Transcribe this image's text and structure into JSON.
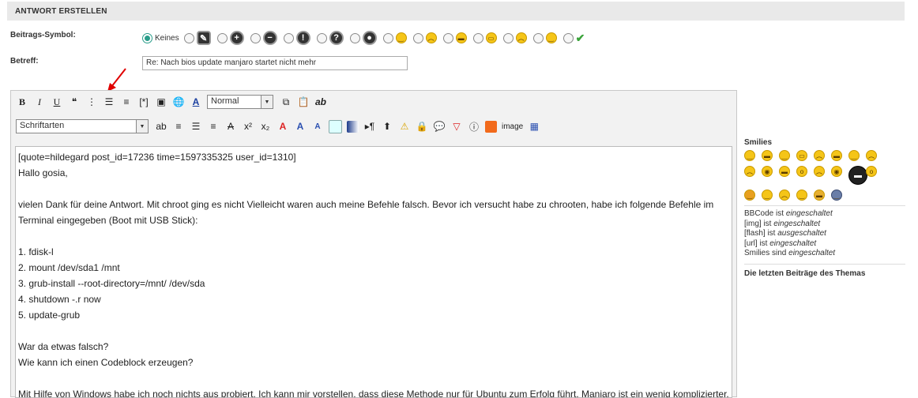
{
  "header": {
    "title": "ANTWORT ERSTELLEN"
  },
  "form": {
    "icon_label": "Beitrags-Symbol:",
    "none_label": "Keines",
    "subject_label": "Betreff:",
    "subject_value": "Re: Nach bios update manjaro startet nicht mehr"
  },
  "post_icons": [
    "edit-icon",
    "plus-icon",
    "minus-icon",
    "exclamation-icon",
    "question-icon",
    "lightbulb-icon",
    "smile-icon",
    "angry-icon",
    "grin-icon",
    "laugh-icon",
    "sad-icon",
    "wink-icon",
    "checkmark-icon"
  ],
  "toolbar": {
    "row1": {
      "bold": "B",
      "italic": "I",
      "underline": "U",
      "format_select": "Normal",
      "ab": "ab"
    },
    "row2": {
      "font_select": "Schriftarten",
      "image_label": "image"
    }
  },
  "message": "[quote=hildegard post_id=17236 time=1597335325 user_id=1310]\nHallo gosia,\n\nvielen Dank für deine Antwort. Mit chroot ging es nicht Vielleicht waren auch meine Befehle falsch. Bevor ich versucht habe zu chrooten, habe ich folgende Befehle im Terminal eingegeben (Boot mit USB Stick):\n\n1. fdisk-l\n2. mount /dev/sda1 /mnt\n3. grub-install --root-directory=/mnt/ /dev/sda\n4. shutdown -.r now\n5. update-grub\n\nWar da etwas falsch?\nWie kann ich einen Codeblock erzeugen?\n\nMit Hilfe von Windows habe ich noch nichts aus probiert. Ich kann mir vorstellen, dass diese Methode nur für Ubuntu zum Erfolg führt. Manjaro ist ein wenig komplizierter.",
  "sidebar": {
    "smilies_title": "Smilies",
    "bbcode": {
      "prefix": "BBCode ist ",
      "state": "eingeschaltet"
    },
    "img": {
      "prefix": "[img] ist ",
      "state": "eingeschaltet"
    },
    "flash": {
      "prefix": "[flash] ist ",
      "state": "ausgeschaltet"
    },
    "url": {
      "prefix": "[url] ist ",
      "state": "eingeschaltet"
    },
    "smilies": {
      "prefix": "Smilies sind ",
      "state": "eingeschaltet"
    },
    "last_posts_title": "Die letzten Beiträge des Themas"
  },
  "colors": {
    "accent_radio": "#2a9d8a",
    "header_bg": "#e9e9e9",
    "arrow": "#e00000"
  }
}
